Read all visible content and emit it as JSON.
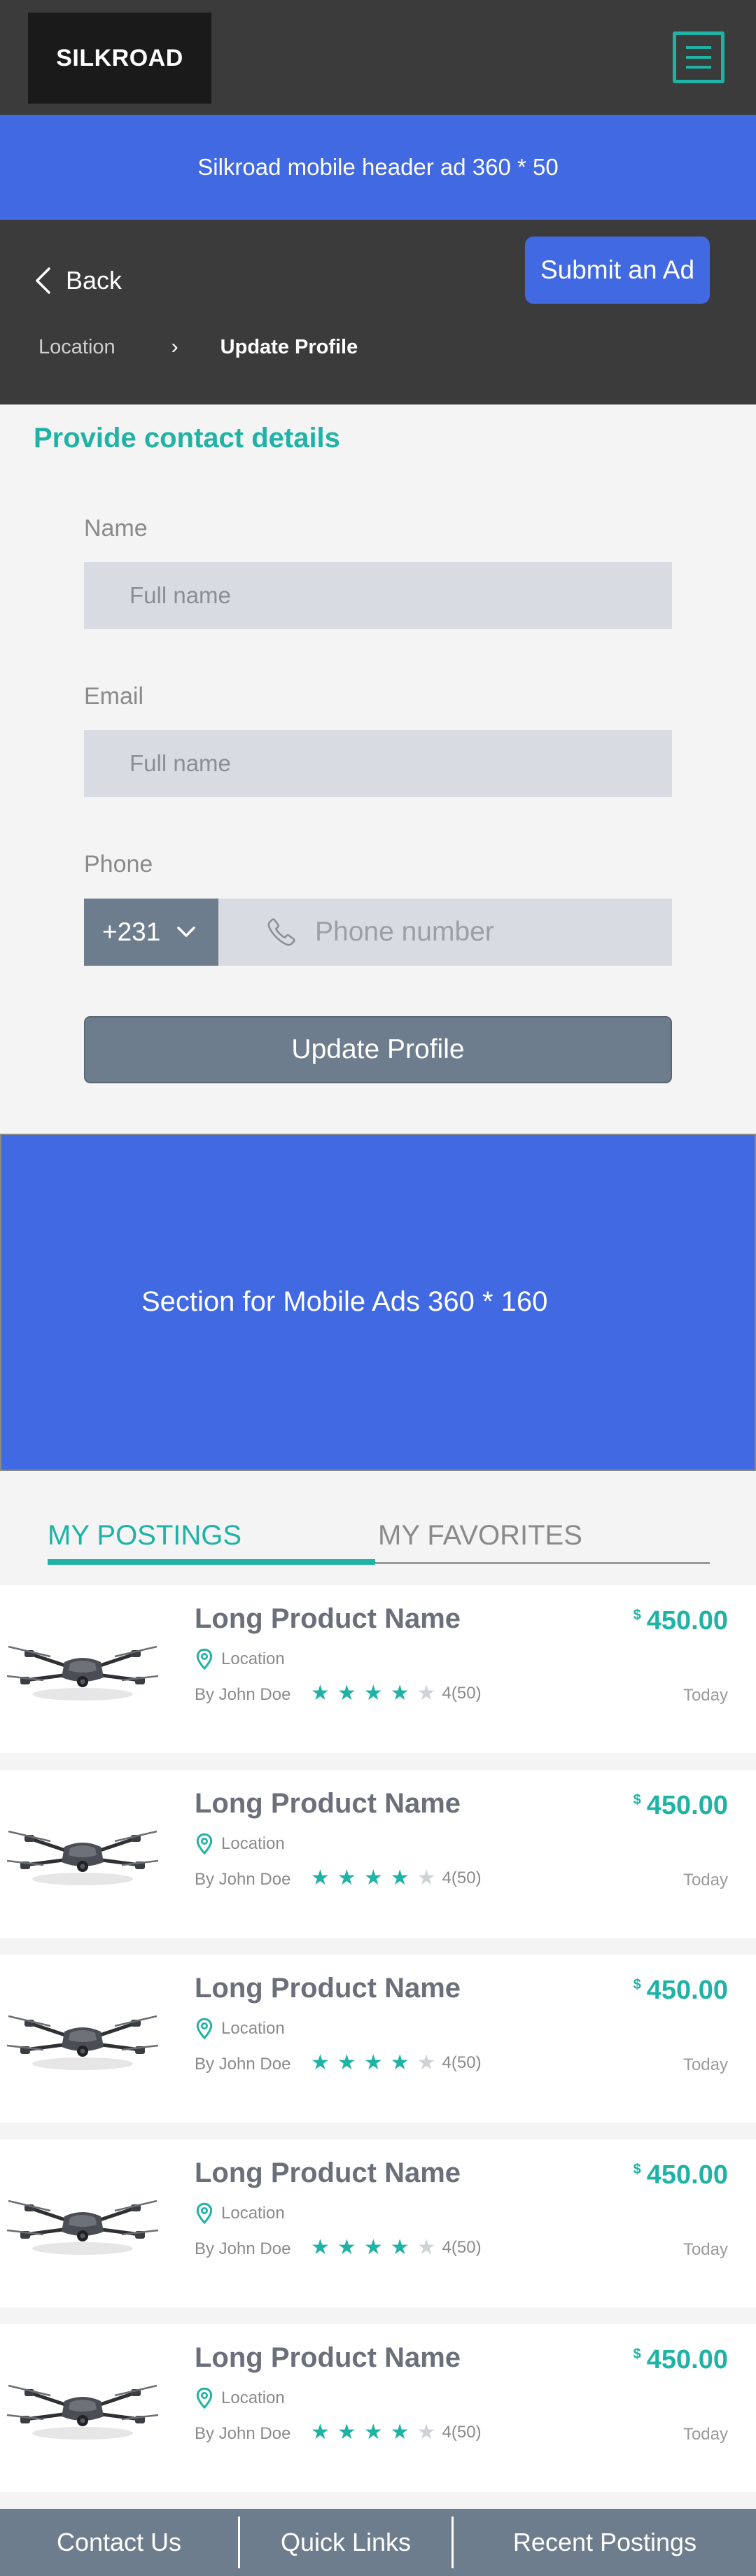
{
  "app": {
    "logo": "SILKROAD"
  },
  "header_ad": {
    "text": "Silkroad mobile header ad 360 * 50"
  },
  "subnav": {
    "back_label": "Back",
    "submit_label": "Submit an Ad",
    "breadcrumb": {
      "location": "Location",
      "separator": "›",
      "current": "Update Profile"
    }
  },
  "form": {
    "title": "Provide contact details",
    "name": {
      "label": "Name",
      "placeholder": "Full name"
    },
    "email": {
      "label": "Email",
      "placeholder": "Full name"
    },
    "phone": {
      "label": "Phone",
      "country_code": "+231",
      "placeholder": "Phone number"
    },
    "submit_label": "Update Profile"
  },
  "mid_ad": {
    "text": "Section for Mobile Ads 360 * 160"
  },
  "tabs": {
    "active": "MY POSTINGS",
    "inactive": "MY FAVORITES"
  },
  "products": [
    {
      "title": "Long Product Name",
      "location": "Location",
      "by": "By John Doe",
      "rating_value": 4,
      "rating_text": "4(50)",
      "currency": "$",
      "price": "450.00",
      "date": "Today"
    },
    {
      "title": "Long Product Name",
      "location": "Location",
      "by": "By John Doe",
      "rating_value": 4,
      "rating_text": "4(50)",
      "currency": "$",
      "price": "450.00",
      "date": "Today"
    },
    {
      "title": "Long Product Name",
      "location": "Location",
      "by": "By John Doe",
      "rating_value": 4,
      "rating_text": "4(50)",
      "currency": "$",
      "price": "450.00",
      "date": "Today"
    },
    {
      "title": "Long Product Name",
      "location": "Location",
      "by": "By John Doe",
      "rating_value": 4,
      "rating_text": "4(50)",
      "currency": "$",
      "price": "450.00",
      "date": "Today"
    },
    {
      "title": "Long Product Name",
      "location": "Location",
      "by": "By John Doe",
      "rating_value": 4,
      "rating_text": "4(50)",
      "currency": "$",
      "price": "450.00",
      "date": "Today"
    }
  ],
  "footer": {
    "links": [
      "Contact Us",
      "Quick Links",
      "Recent Postings"
    ]
  },
  "colors": {
    "accent": "#1fb3a5",
    "blue": "#4169e1",
    "dark": "#3b3b3b",
    "slate": "#6e7d8d"
  }
}
